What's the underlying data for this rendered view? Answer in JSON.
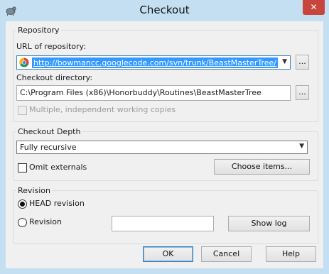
{
  "window": {
    "title": "Checkout",
    "close_label": "✕"
  },
  "repository": {
    "legend": "Repository",
    "url_label": "URL of repository:",
    "url_value": "http://bowmancc.googlecode.com/svn/trunk/BeastMasterTree/",
    "url_browse": "...",
    "dir_label": "Checkout directory:",
    "dir_value": "C:\\Program Files (x86)\\Honorbuddy\\Routines\\BeastMasterTree",
    "dir_browse": "...",
    "multiple_label": "Multiple, independent working copies",
    "multiple_checked": false,
    "multiple_enabled": false
  },
  "depth": {
    "legend": "Checkout Depth",
    "selected": "Fully recursive",
    "omit_label": "Omit externals",
    "omit_checked": false,
    "choose_button": "Choose items..."
  },
  "revision": {
    "legend": "Revision",
    "head_label": "HEAD revision",
    "head_checked": true,
    "revision_label": "Revision",
    "revision_value": "",
    "show_log_button": "Show log"
  },
  "buttons": {
    "ok": "OK",
    "cancel": "Cancel",
    "help": "Help"
  },
  "colors": {
    "frame": "#c5dff2",
    "selection": "#3399ff",
    "close": "#c7453c"
  }
}
